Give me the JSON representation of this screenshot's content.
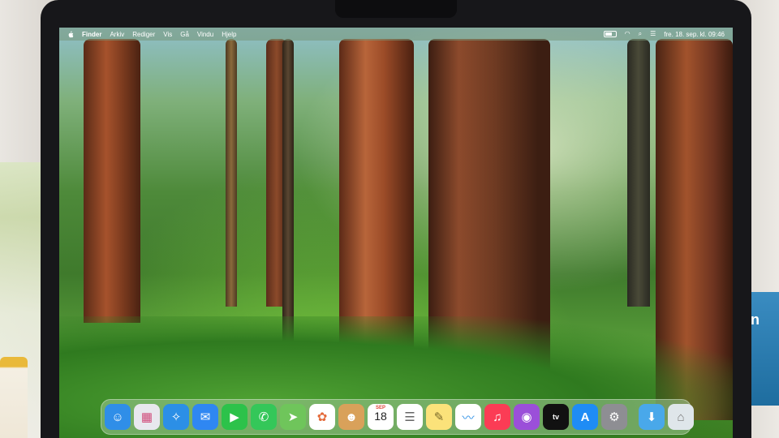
{
  "menubar": {
    "app_name": "Finder",
    "menus": [
      "Arkiv",
      "Rediger",
      "Vis",
      "Gå",
      "Vindu",
      "Hjelp"
    ],
    "datetime": "fre. 18. sep. kl. 09:46"
  },
  "dock": {
    "apps": [
      {
        "name": "finder-icon",
        "bg": "#2f8ee8",
        "glyph": "☺"
      },
      {
        "name": "launchpad-icon",
        "bg": "#e8e8ee",
        "glyph": "▦"
      },
      {
        "name": "safari-icon",
        "bg": "#2c8fe6",
        "glyph": "✧"
      },
      {
        "name": "mail-icon",
        "bg": "#2f87f2",
        "glyph": "✉"
      },
      {
        "name": "facetime-icon",
        "bg": "#2cc24a",
        "glyph": "▶"
      },
      {
        "name": "messages-icon",
        "bg": "#34c759",
        "glyph": "💬"
      },
      {
        "name": "maps-icon",
        "bg": "#6fc55b",
        "glyph": "➤"
      },
      {
        "name": "photos-icon",
        "bg": "#ffffff",
        "glyph": "✿"
      },
      {
        "name": "contacts-icon",
        "bg": "#d9a15a",
        "glyph": "☻"
      }
    ],
    "calendar": {
      "month": "SEP",
      "day": "18"
    },
    "apps2": [
      {
        "name": "reminders-icon",
        "bg": "#ffffff",
        "glyph": "☰"
      },
      {
        "name": "notes-icon",
        "bg": "#fbe27a",
        "glyph": "✎"
      },
      {
        "name": "freeform-icon",
        "bg": "#ffffff",
        "glyph": "〰"
      },
      {
        "name": "music-icon",
        "bg": "#fb3c55",
        "glyph": "♫"
      },
      {
        "name": "podcasts-icon",
        "bg": "#9b4fd9",
        "glyph": "◉"
      }
    ],
    "tv_label": "tv",
    "apps3": [
      {
        "name": "app-store-icon",
        "bg": "#1f8cf5",
        "glyph": "A"
      },
      {
        "name": "system-settings-icon",
        "bg": "#8e8e93",
        "glyph": "⚙"
      }
    ],
    "apps4": [
      {
        "name": "downloads-folder-icon",
        "bg": "#49a8ea",
        "glyph": "⬇"
      },
      {
        "name": "trash-icon",
        "bg": "#dfe6ea",
        "glyph": "🗑"
      }
    ]
  },
  "background_book_text": "on"
}
